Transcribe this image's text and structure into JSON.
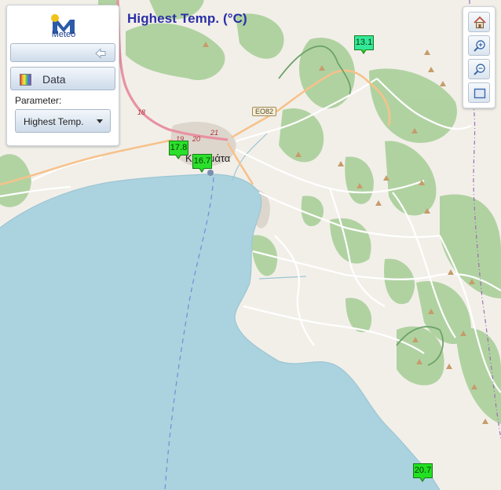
{
  "map": {
    "title": "Highest Temp. (°C)",
    "city_label": "Καλαμάτα",
    "route_shield": "EO82",
    "road_numbers": [
      "18",
      "19",
      "20",
      "21"
    ],
    "colors": {
      "sea": "#aad3df",
      "land": "#f2efe9",
      "forest": "#add19e",
      "road_major": "#e892a2",
      "road_minor": "#f6c28b"
    }
  },
  "panel": {
    "logo_text": "Meteo",
    "collapse_icon": "arrow-left-icon",
    "data_label": "Data",
    "parameter_label": "Parameter:",
    "parameter_value": "Highest Temp."
  },
  "toolbar": {
    "buttons": [
      {
        "icon": "home-icon"
      },
      {
        "icon": "zoom-in-icon"
      },
      {
        "icon": "zoom-out-icon"
      },
      {
        "icon": "fullscreen-icon"
      }
    ]
  },
  "stations": [
    {
      "value": "13.1",
      "color": "#33e89a"
    },
    {
      "value": "17.8",
      "color": "#2be02b"
    },
    {
      "value": "16.7",
      "color": "#2be02b"
    },
    {
      "value": "20.7",
      "color": "#22e022"
    }
  ]
}
